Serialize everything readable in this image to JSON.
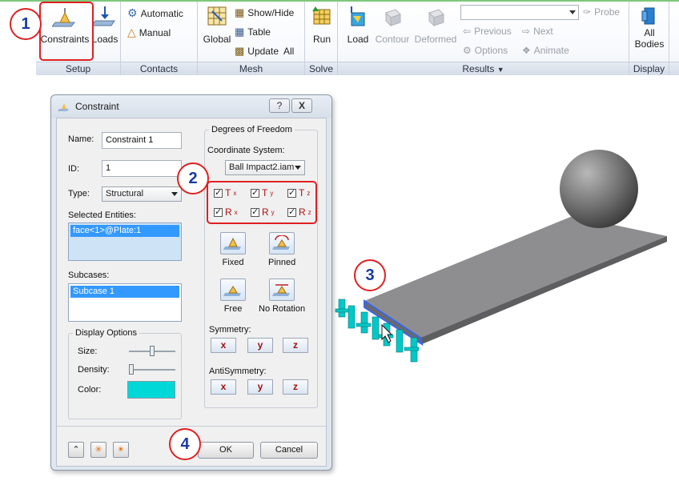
{
  "ribbon": {
    "groups": {
      "setup": "Setup",
      "contacts": "Contacts",
      "mesh": "Mesh",
      "solve": "Solve",
      "results": "Results",
      "display": "Display"
    },
    "constraints_label": "Constraints",
    "loads_label": "Loads",
    "automatic_label": "Automatic",
    "manual_label": "Manual",
    "global_label": "Global",
    "show_hide_label": "Show/Hide",
    "table_label": "Table",
    "update_all_label": "Update  All",
    "run_label": "Run",
    "load_label": "Load",
    "contour_label": "Contour",
    "deformed_label": "Deformed",
    "probe_label": "Probe",
    "previous_label": "Previous",
    "next_label": "Next",
    "options_label": "Options",
    "animate_label": "Animate",
    "all_bodies_label_1": "All",
    "all_bodies_label_2": "Bodies"
  },
  "dialog": {
    "title": "Constraint",
    "help_label": "?",
    "close_label": "X",
    "name_label": "Name:",
    "name_value": "Constraint 1",
    "id_label": "ID:",
    "id_value": "1",
    "type_label": "Type:",
    "type_value": "Structural",
    "selected_entities_label": "Selected Entities:",
    "selected_entity": "face<1>@Plate:1",
    "subcases_label": "Subcases:",
    "subcase": "Subcase 1",
    "display_options_label": "Display Options",
    "size_label": "Size:",
    "density_label": "Density:",
    "color_label": "Color:",
    "color_value": "#00d8d8",
    "size_level": 0.5,
    "density_level": 0.0,
    "dof_title": "Degrees of Freedom",
    "coord_system_label": "Coordinate System:",
    "coord_system_value": "Ball Impact2.iam",
    "dof": {
      "tx": "T",
      "tx_sub": "x",
      "ty": "T",
      "ty_sub": "y",
      "tz": "T",
      "tz_sub": "z",
      "rx": "R",
      "rx_sub": "x",
      "ry": "R",
      "ry_sub": "y",
      "rz": "R",
      "rz_sub": "z"
    },
    "fixed_label": "Fixed",
    "pinned_label": "Pinned",
    "free_label": "Free",
    "no_rotation_label": "No Rotation",
    "symmetry_label": "Symmetry:",
    "antisymmetry_label": "AntiSymmetry:",
    "axis_x": "x",
    "axis_y": "y",
    "axis_z": "z",
    "ok_label": "OK",
    "cancel_label": "Cancel"
  },
  "callouts": {
    "one": "1",
    "two": "2",
    "three": "3",
    "four": "4"
  },
  "colors": {
    "highlight_red": "#e02020",
    "callout_blue": "#1a3aa0",
    "constraint_cyan": "#00d8d8"
  }
}
